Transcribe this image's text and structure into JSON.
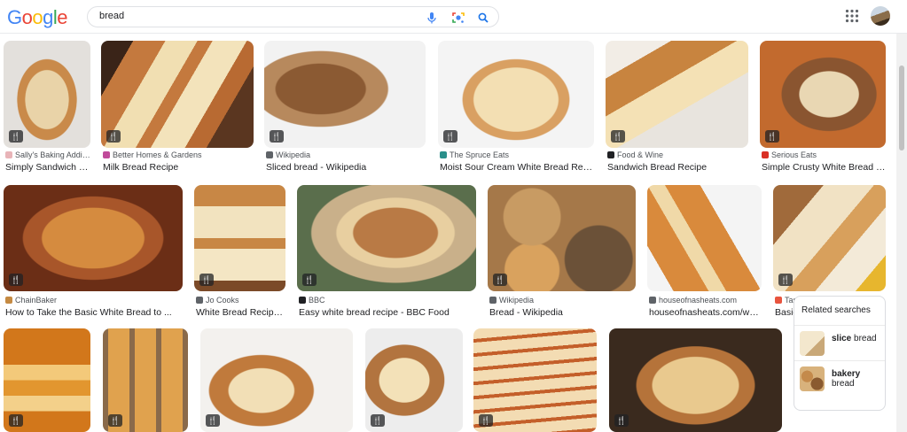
{
  "header": {
    "logo_letters": [
      "G",
      "o",
      "o",
      "g",
      "l",
      "e"
    ],
    "logo_colors": [
      "#4285f4",
      "#ea4335",
      "#fbbc05",
      "#4285f4",
      "#34a853",
      "#ea4335"
    ],
    "search_value": "bread",
    "icons": [
      "mic-icon",
      "lens-icon",
      "search-icon",
      "apps-icon"
    ]
  },
  "results": [
    {
      "source": "Sally's Baking Addic...",
      "title": "Simply Sandwich Br...",
      "source_icon_color": "#e8b4b8"
    },
    {
      "source": "Better Homes & Gardens",
      "title": "Milk Bread Recipe",
      "source_icon_color": "#c04b9a"
    },
    {
      "source": "Wikipedia",
      "title": "Sliced bread - Wikipedia",
      "source_icon_color": "#5f6368"
    },
    {
      "source": "The Spruce Eats",
      "title": "Moist Sour Cream White Bread Recipe",
      "source_icon_color": "#2a8f8a"
    },
    {
      "source": "Food & Wine",
      "title": "Sandwich Bread Recipe",
      "source_icon_color": "#202124"
    },
    {
      "source": "Serious Eats",
      "title": "Simple Crusty White Bread Re...",
      "source_icon_color": "#d93025"
    },
    {
      "source": "ChainBaker",
      "title": "How to Take the Basic White Bread to ...",
      "source_icon_color": "#c58a42"
    },
    {
      "source": "Jo Cooks",
      "title": "White Bread Recipe -...",
      "source_icon_color": "#5f6368"
    },
    {
      "source": "BBC",
      "title": "Easy white bread recipe - BBC Food",
      "source_icon_color": "#202124"
    },
    {
      "source": "Wikipedia",
      "title": "Bread - Wikipedia",
      "source_icon_color": "#5f6368"
    },
    {
      "source": "houseofnasheats.com",
      "title": "houseofnasheats.com/wp-...",
      "source_icon_color": "#5f6368"
    },
    {
      "source": "Taste of Home",
      "title": "Basic Homemade Bread R...",
      "source_icon_color": "#e8543e"
    }
  ],
  "related": {
    "title": "Related searches",
    "items": [
      {
        "bold": "slice",
        "rest": "bread"
      },
      {
        "bold": "bakery",
        "rest": "bread"
      }
    ]
  },
  "colors": {
    "accent": "#1a73e8",
    "text": "#202124",
    "muted": "#4d5156"
  }
}
